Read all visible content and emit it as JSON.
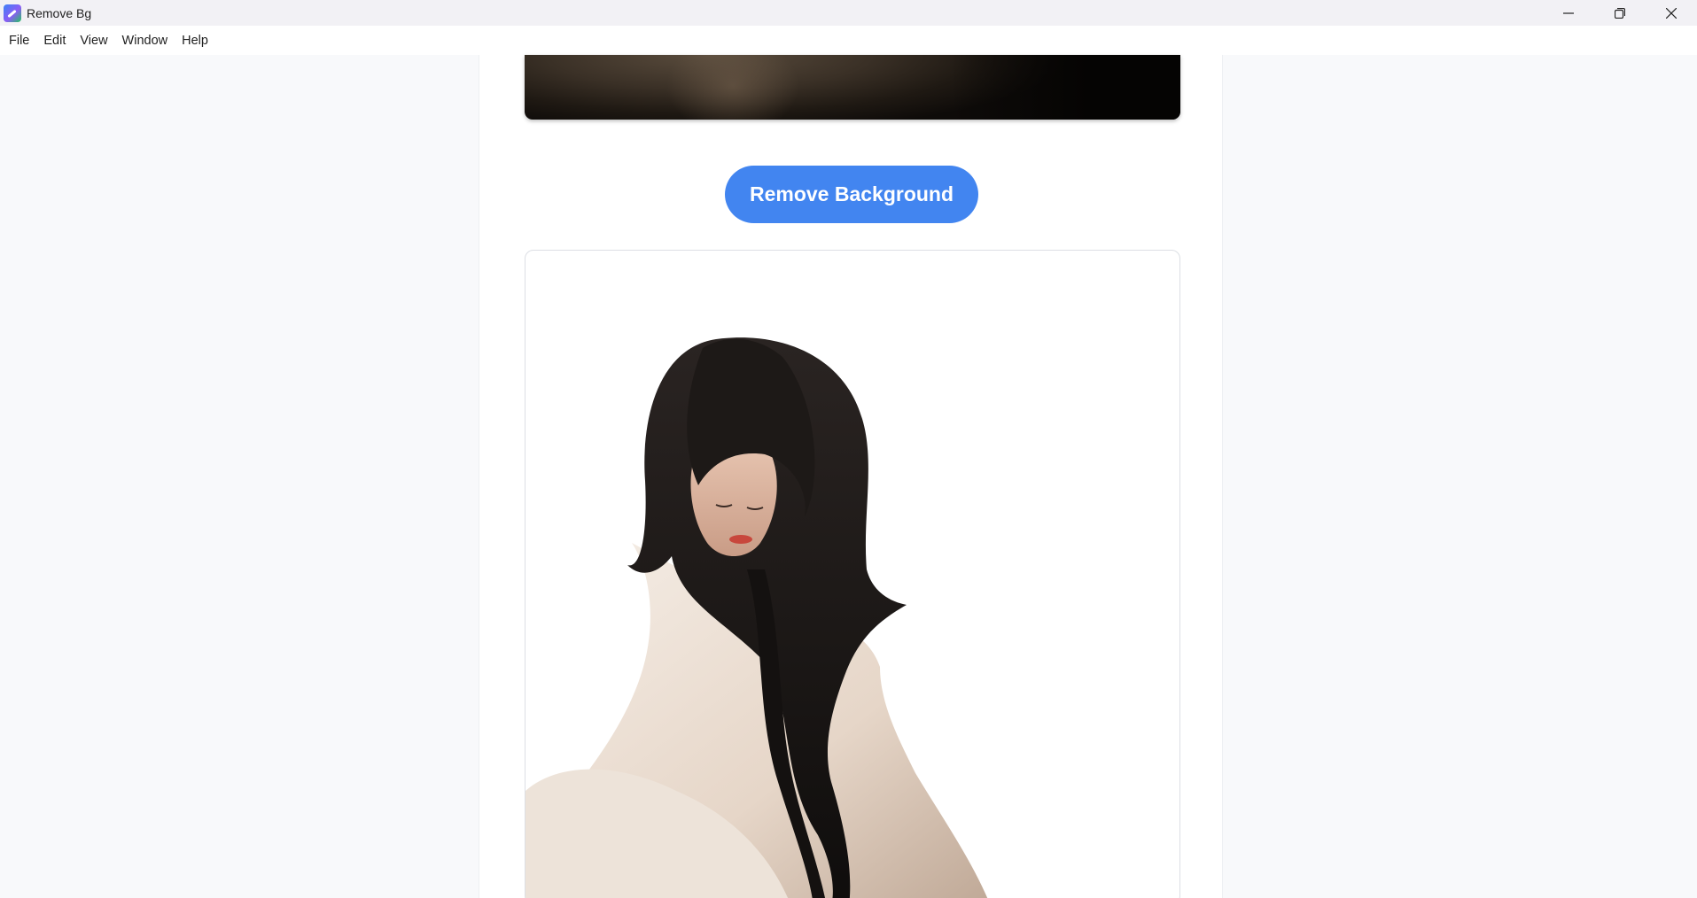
{
  "window": {
    "title": "Remove Bg",
    "app_icon": "remove-bg-app-icon",
    "controls": [
      "minimize-icon",
      "restore-icon",
      "close-icon"
    ]
  },
  "menu": {
    "items": [
      "File",
      "Edit",
      "View",
      "Window",
      "Help"
    ]
  },
  "main": {
    "original_image": {
      "description_icon": "photo"
    },
    "action_button_label": "Remove Background",
    "result_image": {
      "description_icon": "photo-background-removed"
    }
  },
  "colors": {
    "accent": "#4285f0",
    "page_background": "#f8f9fb",
    "panel_background": "#ffffff"
  }
}
